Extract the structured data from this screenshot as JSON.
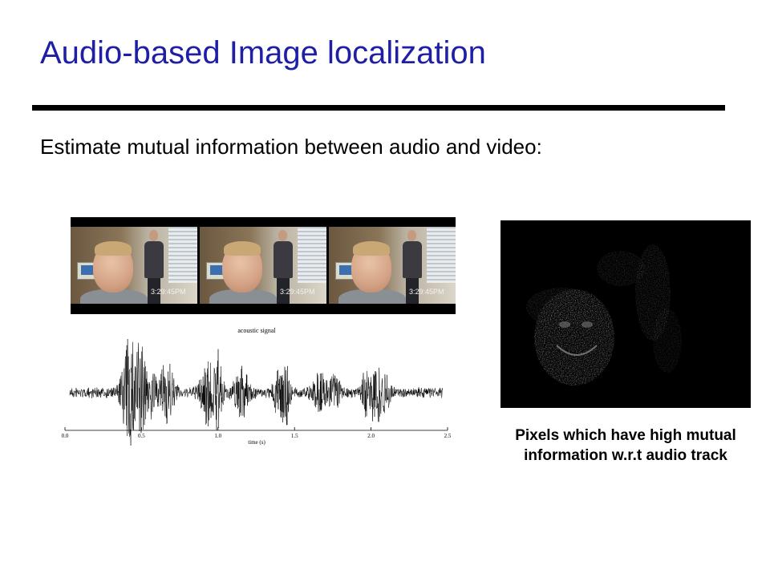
{
  "slide": {
    "title": "Audio-based Image localization",
    "subtitle": "Estimate mutual information between audio and video:"
  },
  "filmstrip": {
    "timestamps": [
      "3:29:45PM",
      "3:29:45PM",
      "3:29:45PM"
    ]
  },
  "waveform": {
    "title": "acoustic signal",
    "xlabel": "time (s)",
    "ticks": [
      "0.0",
      "0.5",
      "1.0",
      "1.5",
      "2.0",
      "2.5"
    ]
  },
  "mi_map": {
    "caption": "Pixels which have high mutual information w.r.t audio track"
  }
}
